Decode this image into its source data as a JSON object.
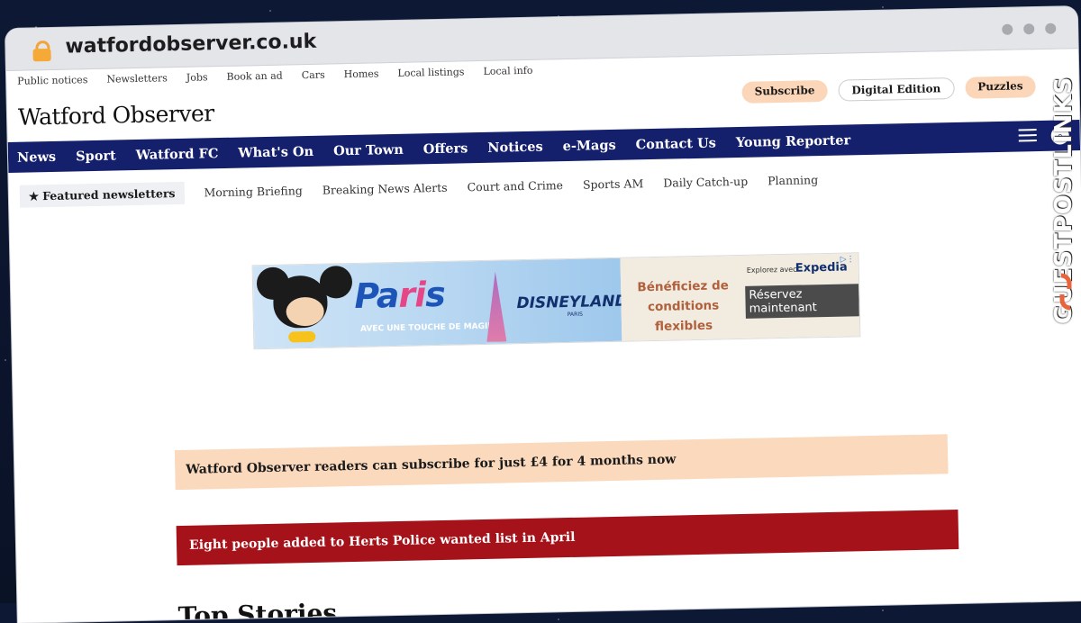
{
  "browser": {
    "url": "watfordobserver.co.uk"
  },
  "topnav": [
    "Public notices",
    "Newsletters",
    "Jobs",
    "Book an ad",
    "Cars",
    "Homes",
    "Local listings",
    "Local info"
  ],
  "header": {
    "logo": "Watford Observer",
    "subscribe": "Subscribe",
    "digital": "Digital Edition",
    "puzzles": "Puzzles"
  },
  "mainnav": [
    "News",
    "Sport",
    "Watford FC",
    "What's On",
    "Our Town",
    "Offers",
    "Notices",
    "e-Mags",
    "Contact Us",
    "Young Reporter"
  ],
  "newsletters": {
    "featured": "Featured newsletters",
    "items": [
      "Morning Briefing",
      "Breaking News Alerts",
      "Court and Crime",
      "Sports AM",
      "Daily Catch-up",
      "Planning"
    ]
  },
  "ad": {
    "headline_a": "Pa",
    "headline_b": "ri",
    "headline_c": "s",
    "tagline": "AVEC UNE TOUCHE DE MAGIE",
    "brand": "DISNEYLAND",
    "brand_sub": "PARIS",
    "offer": "Bénéficiez de conditions flexibles",
    "explore": "Explorez avec",
    "partner": "Expedia",
    "cta": "Réservez maintenant"
  },
  "promo": "Watford Observer readers can subscribe for just £4 for 4 months now",
  "breaking": "Eight people added to Herts Police wanted list in April",
  "section_title": "Top Stories",
  "watermark": "GUESTPOSTLINKS",
  "colors": {
    "nav": "#14206c",
    "breaking": "#a5121a",
    "promo": "#fbd9bd",
    "pill": "#fbd6b8"
  }
}
